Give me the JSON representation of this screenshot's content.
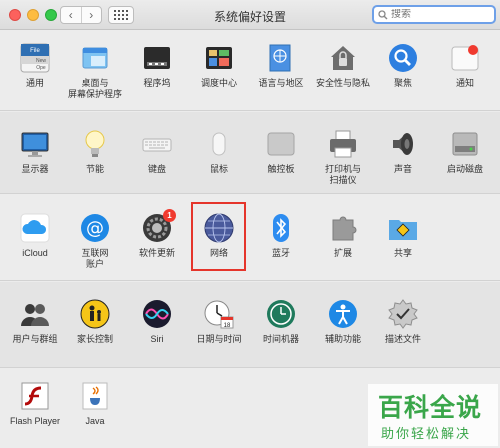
{
  "window": {
    "title": "系统偏好设置"
  },
  "search": {
    "placeholder": "搜索"
  },
  "rows": [
    [
      {
        "name": "general",
        "label": "通用",
        "icon": "general-icon"
      },
      {
        "name": "desktop-screensaver",
        "label": "桌面与\n屏幕保护程序",
        "icon": "desktop-icon"
      },
      {
        "name": "dock",
        "label": "程序坞",
        "icon": "dock-icon"
      },
      {
        "name": "mission-control",
        "label": "调度中心",
        "icon": "mission-control-icon"
      },
      {
        "name": "language-region",
        "label": "语言与地区",
        "icon": "flag-icon"
      },
      {
        "name": "security-privacy",
        "label": "安全性与隐私",
        "icon": "house-lock-icon"
      },
      {
        "name": "spotlight",
        "label": "聚焦",
        "icon": "magnifier-icon"
      },
      {
        "name": "notifications",
        "label": "通知",
        "icon": "notification-icon"
      }
    ],
    [
      {
        "name": "displays",
        "label": "显示器",
        "icon": "display-icon"
      },
      {
        "name": "energy-saver",
        "label": "节能",
        "icon": "lightbulb-icon"
      },
      {
        "name": "keyboard",
        "label": "键盘",
        "icon": "keyboard-icon"
      },
      {
        "name": "mouse",
        "label": "鼠标",
        "icon": "mouse-icon"
      },
      {
        "name": "trackpad",
        "label": "触控板",
        "icon": "trackpad-icon"
      },
      {
        "name": "printers-scanners",
        "label": "打印机与\n扫描仪",
        "icon": "printer-icon"
      },
      {
        "name": "sound",
        "label": "声音",
        "icon": "speaker-icon"
      },
      {
        "name": "startup-disk",
        "label": "启动磁盘",
        "icon": "disk-icon"
      }
    ],
    [
      {
        "name": "icloud",
        "label": "iCloud",
        "icon": "cloud-icon"
      },
      {
        "name": "internet-accounts",
        "label": "互联网\n账户",
        "icon": "at-sign-icon"
      },
      {
        "name": "software-update",
        "label": "软件更新",
        "icon": "gear-icon",
        "badge": "1"
      },
      {
        "name": "network",
        "label": "网络",
        "icon": "globe-icon"
      },
      {
        "name": "bluetooth",
        "label": "蓝牙",
        "icon": "bluetooth-icon"
      },
      {
        "name": "extensions",
        "label": "扩展",
        "icon": "puzzle-icon"
      },
      {
        "name": "sharing",
        "label": "共享",
        "icon": "folder-sign-icon"
      }
    ],
    [
      {
        "name": "users-groups",
        "label": "用户与群组",
        "icon": "users-icon"
      },
      {
        "name": "parental-controls",
        "label": "家长控制",
        "icon": "parental-icon"
      },
      {
        "name": "siri",
        "label": "Siri",
        "icon": "siri-icon"
      },
      {
        "name": "date-time",
        "label": "日期与时间",
        "icon": "clock-icon"
      },
      {
        "name": "time-machine",
        "label": "时间机器",
        "icon": "time-machine-icon"
      },
      {
        "name": "accessibility",
        "label": "辅助功能",
        "icon": "accessibility-icon"
      },
      {
        "name": "profiles",
        "label": "描述文件",
        "icon": "checkmark-badge-icon"
      }
    ],
    [
      {
        "name": "flash-player",
        "label": "Flash Player",
        "icon": "flash-icon"
      },
      {
        "name": "java",
        "label": "Java",
        "icon": "java-cup-icon"
      }
    ]
  ],
  "date_icon_text": "18",
  "watermark": {
    "title": "百科全说",
    "subtitle": "助你轻松解决"
  },
  "colors": {
    "highlight": "#e5352b",
    "accent": "#1a8cf0",
    "badge": "#f03a2f",
    "watermark": "#3aa64a"
  }
}
